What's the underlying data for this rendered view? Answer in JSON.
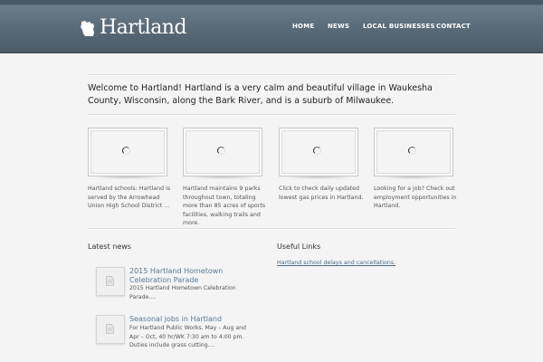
{
  "header": {
    "logo_text": "Hartland",
    "logo_icon": "wisconsin-map-icon",
    "nav": [
      {
        "label": "HOME"
      },
      {
        "label": "NEWS"
      },
      {
        "label": "LOCAL BUSINESSES"
      },
      {
        "label": "CONTACT"
      }
    ]
  },
  "intro": {
    "text": "Welcome to Hartland! Hartland is a very calm and beautiful village in Waukesha County, Wisconsin, along the Bark River, and is a suburb of Milwaukee."
  },
  "features": [
    {
      "caption": "Hartland schools: Hartland is served by the Arrowhead Union High School District ...",
      "icon": "loading-spinner-icon"
    },
    {
      "caption": "Hartland maintains 9 parks throughout town, totaling more than 85 acres of sports facilities, walking trails and more.",
      "icon": "loading-spinner-icon"
    },
    {
      "caption": "Click to check daily updated lowest gas prices in Hartland.",
      "icon": "loading-spinner-icon"
    },
    {
      "caption": "Looking for a job? Check out employment opportunities in Hartland.",
      "icon": "loading-spinner-icon"
    }
  ],
  "latest_news": {
    "title": "Latest news",
    "items": [
      {
        "title": "2015 Hartland Hometown Celebration Parade",
        "excerpt": "2015 Hartland Hometown Celebration Parade....",
        "icon": "document-icon"
      },
      {
        "title": "Seasonal jobs in Hartland",
        "excerpt": "For Hartland Public Works, May – Aug and Apr – Oct, 40 hr/WK 7:30 am to 4:00 pm. Duties include grass cutting....",
        "icon": "document-icon"
      }
    ]
  },
  "useful_links": {
    "title": "Useful Links",
    "items": [
      {
        "label": "Hartland school delays and cancellations."
      }
    ]
  },
  "colors": {
    "header": "#56677a",
    "link": "#5c7896",
    "background": "#f4f4f4"
  }
}
